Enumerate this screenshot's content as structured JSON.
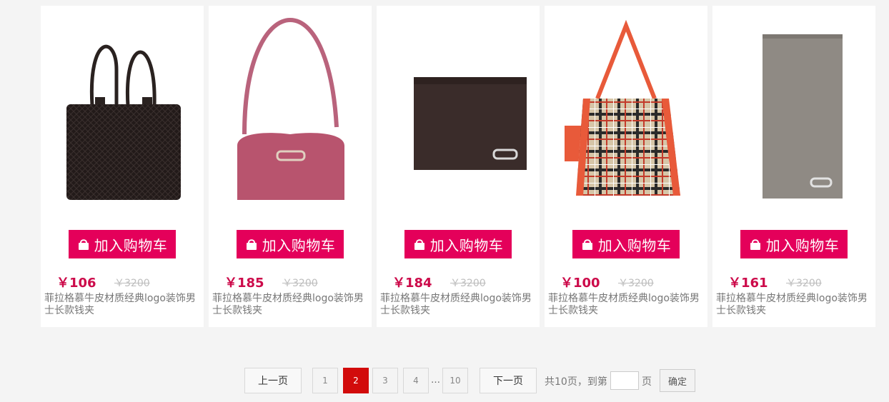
{
  "products": [
    {
      "image": "black-leather-briefcase",
      "cart_label": "加入购物车",
      "price": "￥106",
      "old_price": "￥3200",
      "desc": "菲拉格慕牛皮材质经典logo装饰男士长款钱夹"
    },
    {
      "image": "pink-shoulder-bag",
      "cart_label": "加入购物车",
      "price": "￥185",
      "old_price": "￥3200",
      "desc": "菲拉格慕牛皮材质经典logo装饰男士长款钱夹"
    },
    {
      "image": "brown-bifold-wallet",
      "cart_label": "加入购物车",
      "price": "￥184",
      "old_price": "￥3200",
      "desc": "菲拉格慕牛皮材质经典logo装饰男士长款钱夹"
    },
    {
      "image": "plaid-tote-bag",
      "cart_label": "加入购物车",
      "price": "￥100",
      "old_price": "￥3200",
      "desc": "菲拉格慕牛皮材质经典logo装饰男士长款钱夹"
    },
    {
      "image": "grey-long-wallet",
      "cart_label": "加入购物车",
      "price": "￥161",
      "old_price": "￥3200",
      "desc": "菲拉格慕牛皮材质经典logo装饰男士长款钱夹"
    }
  ],
  "colors": {
    "accent": "#e4005a",
    "price": "#cc0a4a",
    "active_page": "#d20b0b"
  },
  "pagination": {
    "prev": "上一页",
    "pages": [
      "1",
      "2",
      "3",
      "4"
    ],
    "current": "2",
    "ellipsis": "…",
    "last": "10",
    "next": "下一页",
    "total": "共10页，到第",
    "goto_value": "",
    "page_unit": "页",
    "confirm": "确定"
  }
}
